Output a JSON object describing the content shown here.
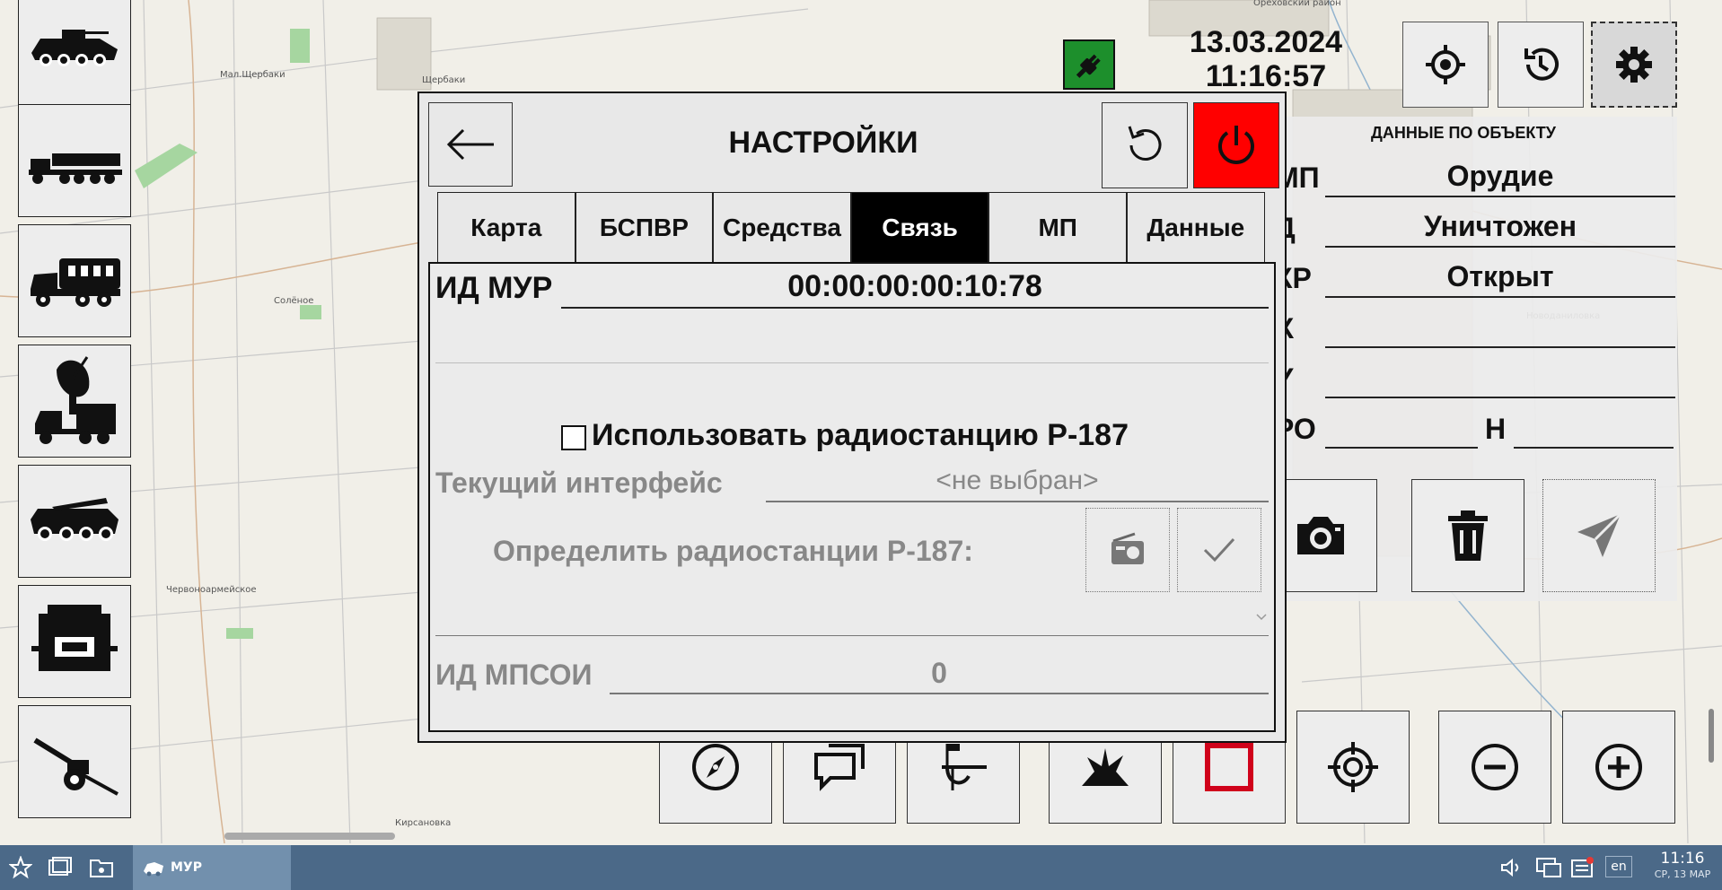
{
  "map": {
    "place_labels": [
      "Ореховский район",
      "Мал.Щербаки",
      "Щербаки",
      "Новоданиловка",
      "Червоноармейское",
      "Кирсановка",
      "Солёное"
    ]
  },
  "sidebar": {
    "items": [
      {
        "name": "apc"
      },
      {
        "name": "rocket-launcher"
      },
      {
        "name": "truck"
      },
      {
        "name": "radar"
      },
      {
        "name": "missile-carrier"
      },
      {
        "name": "shelter"
      },
      {
        "name": "howitzer"
      }
    ]
  },
  "status": {
    "date": "13.03.2024",
    "time": "11:16:57",
    "connection_color": "#1d8f2c"
  },
  "object_panel": {
    "title": "ДАННЫЕ ПО ОБЪЕКТУ",
    "rows": [
      {
        "key": "МП",
        "value": "Орудие"
      },
      {
        "key": "Д",
        "value": "Уничтожен"
      },
      {
        "key": "КР",
        "value": "Открыт"
      },
      {
        "key": "Х",
        "value": ""
      },
      {
        "key": "Y",
        "value": ""
      },
      {
        "key": "РО",
        "value": "",
        "value2_label": "Н",
        "value2": ""
      }
    ]
  },
  "dialog": {
    "title": "НАСТРОЙКИ",
    "tabs": [
      "Карта",
      "БСПВР",
      "Средства",
      "Связь",
      "МП",
      "Данные"
    ],
    "active_tab": "Связь",
    "mur_id_label": "ИД МУР",
    "mur_id_value": "00:00:00:00:10:78",
    "use_radio_label": "Использовать радиостанцию Р-187",
    "use_radio_checked": false,
    "current_interface_label": "Текущий интерфейс",
    "current_interface_value": "<не выбран>",
    "detect_label": "Определить радиостанции Р-187:",
    "mpsoi_label": "ИД МПСОИ",
    "mpsoi_value": "0"
  },
  "taskbar": {
    "app_label": "МУР",
    "lang": "en",
    "time": "11:16",
    "date": "СР, 13 МАР"
  },
  "colors": {
    "power_button": "#ff0000",
    "active_tab_bg": "#000000",
    "taskbar_bg": "#4b6988",
    "stop_square": "#d0021b"
  }
}
